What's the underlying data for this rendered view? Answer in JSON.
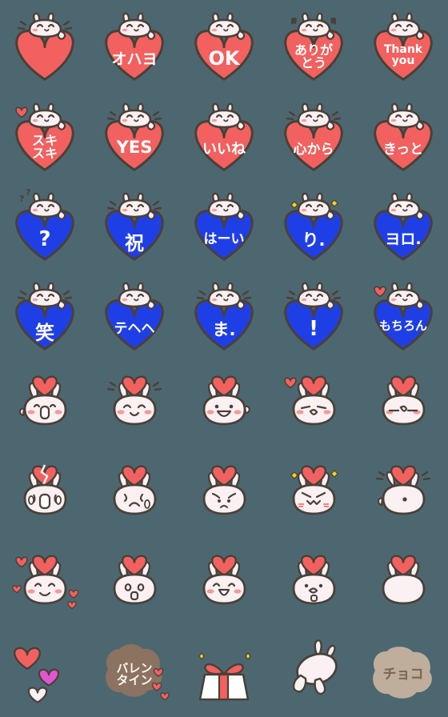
{
  "page": {
    "title": "Heart Rabbit Emoji Set",
    "background_color": "#4d6770",
    "columns": 5,
    "rows": 8,
    "total_items": 40
  },
  "palette": {
    "background": "#4d6770",
    "heart_red": "#f2615f",
    "heart_blue": "#1f3fe6",
    "body_white": "#fbf0f2",
    "outline": "#4a4038",
    "blush": "#f4837f",
    "chocolate_dark": "#8b7261",
    "chocolate_light": "#bfae9c",
    "caption_white": "#ffffff",
    "spark_yellow": "#f5d21c",
    "pink_heart": "#e255d0"
  },
  "items": [
    {
      "id": 1,
      "row": 1,
      "col": 1,
      "kind": "red-heart-rabbit",
      "caption": "",
      "caption_size": 0,
      "name": "emoji-heart-plain",
      "accents": "motion-lines"
    },
    {
      "id": 2,
      "row": 1,
      "col": 2,
      "kind": "red-heart-rabbit",
      "caption": "オハヨ",
      "caption_size": 19,
      "name": "emoji-ohayo",
      "accents": "none"
    },
    {
      "id": 3,
      "row": 1,
      "col": 3,
      "kind": "red-heart-rabbit",
      "caption": "OK",
      "caption_size": 24,
      "name": "emoji-ok",
      "accents": "none"
    },
    {
      "id": 4,
      "row": 1,
      "col": 4,
      "kind": "red-heart-rabbit",
      "caption": "ありが\nとう",
      "caption_size": 16,
      "name": "emoji-arigatou",
      "accents": "music-notes"
    },
    {
      "id": 5,
      "row": 1,
      "col": 5,
      "kind": "red-heart-rabbit",
      "caption": "Thank\nyou",
      "caption_size": 14,
      "name": "emoji-thank-you",
      "accents": "none"
    },
    {
      "id": 6,
      "row": 2,
      "col": 1,
      "kind": "red-heart-rabbit",
      "caption": "スキ\nスキ",
      "caption_size": 16,
      "name": "emoji-suki-suki",
      "accents": "small-heart"
    },
    {
      "id": 7,
      "row": 2,
      "col": 2,
      "kind": "red-heart-rabbit",
      "caption": "YES",
      "caption_size": 21,
      "name": "emoji-yes",
      "accents": "motion-lines"
    },
    {
      "id": 8,
      "row": 2,
      "col": 3,
      "kind": "red-heart-rabbit",
      "caption": "いいね",
      "caption_size": 18,
      "name": "emoji-iine",
      "accents": "none"
    },
    {
      "id": 9,
      "row": 2,
      "col": 4,
      "kind": "red-heart-rabbit",
      "caption": "心から",
      "caption_size": 17,
      "name": "emoji-kokoro-kara",
      "accents": "motion-lines"
    },
    {
      "id": 10,
      "row": 2,
      "col": 5,
      "kind": "red-heart-rabbit",
      "caption": "きっと",
      "caption_size": 17,
      "name": "emoji-kitto",
      "accents": "none"
    },
    {
      "id": 11,
      "row": 3,
      "col": 1,
      "kind": "blue-heart-rabbit",
      "caption": "?",
      "caption_size": 26,
      "name": "emoji-question",
      "accents": "question-marks"
    },
    {
      "id": 12,
      "row": 3,
      "col": 2,
      "kind": "blue-heart-rabbit",
      "caption": "祝",
      "caption_size": 24,
      "name": "emoji-iwai",
      "accents": "motion-lines"
    },
    {
      "id": 13,
      "row": 3,
      "col": 3,
      "kind": "blue-heart-rabbit",
      "caption": "はーい",
      "caption_size": 17,
      "name": "emoji-haai",
      "accents": "none"
    },
    {
      "id": 14,
      "row": 3,
      "col": 4,
      "kind": "blue-heart-rabbit",
      "caption": "り.",
      "caption_size": 21,
      "name": "emoji-ri",
      "accents": "spark"
    },
    {
      "id": 15,
      "row": 3,
      "col": 5,
      "kind": "blue-heart-rabbit",
      "caption": "ヨロ.",
      "caption_size": 19,
      "name": "emoji-yoro",
      "accents": "none"
    },
    {
      "id": 16,
      "row": 4,
      "col": 1,
      "kind": "blue-heart-rabbit",
      "caption": "笑",
      "caption_size": 24,
      "name": "emoji-warai",
      "accents": "motion-lines"
    },
    {
      "id": 17,
      "row": 4,
      "col": 2,
      "kind": "blue-heart-rabbit",
      "caption": "テヘヘ",
      "caption_size": 17,
      "name": "emoji-tehehe",
      "accents": "none"
    },
    {
      "id": 18,
      "row": 4,
      "col": 3,
      "kind": "blue-heart-rabbit",
      "caption": "ま.",
      "caption_size": 21,
      "name": "emoji-ma",
      "accents": "motion-lines"
    },
    {
      "id": 19,
      "row": 4,
      "col": 4,
      "kind": "blue-heart-rabbit",
      "caption": "!",
      "caption_size": 26,
      "name": "emoji-exclamation",
      "accents": "motion-lines"
    },
    {
      "id": 20,
      "row": 4,
      "col": 5,
      "kind": "blue-heart-rabbit",
      "caption": "もちろん",
      "caption_size": 15,
      "name": "emoji-mochiron",
      "accents": "small-heart"
    },
    {
      "id": 21,
      "row": 5,
      "col": 1,
      "kind": "face",
      "face": "open-smile",
      "heart": "red",
      "caption": "",
      "caption_size": 0,
      "name": "emoji-face-open-smile",
      "accents": "none"
    },
    {
      "id": 22,
      "row": 5,
      "col": 2,
      "kind": "face",
      "face": "happy-lines",
      "heart": "red",
      "caption": "",
      "caption_size": 0,
      "name": "emoji-face-happy",
      "accents": "motion-lines"
    },
    {
      "id": 23,
      "row": 5,
      "col": 3,
      "kind": "face",
      "face": "big-grin",
      "heart": "red",
      "caption": "",
      "caption_size": 0,
      "name": "emoji-face-big-grin",
      "accents": "none"
    },
    {
      "id": 24,
      "row": 5,
      "col": 4,
      "kind": "face",
      "face": "kiss",
      "heart": "red",
      "caption": "",
      "caption_size": 0,
      "name": "emoji-face-kiss",
      "accents": "small-heart"
    },
    {
      "id": 25,
      "row": 5,
      "col": 5,
      "kind": "face",
      "face": "flat-kiss",
      "heart": "red",
      "caption": "",
      "caption_size": 0,
      "name": "emoji-face-flat-kiss",
      "accents": "none"
    },
    {
      "id": 26,
      "row": 6,
      "col": 1,
      "kind": "face",
      "face": "crying",
      "heart": "broken",
      "caption": "",
      "caption_size": 0,
      "name": "emoji-face-crying",
      "accents": "none"
    },
    {
      "id": 27,
      "row": 6,
      "col": 2,
      "kind": "face",
      "face": "sad-tear",
      "heart": "red",
      "caption": "",
      "caption_size": 0,
      "name": "emoji-face-sad-tear",
      "accents": "none"
    },
    {
      "id": 28,
      "row": 6,
      "col": 3,
      "kind": "face",
      "face": "worried",
      "heart": "red",
      "caption": "",
      "caption_size": 0,
      "name": "emoji-face-worried",
      "accents": "none"
    },
    {
      "id": 29,
      "row": 6,
      "col": 4,
      "kind": "face",
      "face": "angry",
      "heart": "red",
      "caption": "",
      "caption_size": 0,
      "name": "emoji-face-angry",
      "accents": "spark"
    },
    {
      "id": 30,
      "row": 6,
      "col": 5,
      "kind": "face",
      "face": "turned",
      "heart": "red",
      "caption": "",
      "caption_size": 0,
      "name": "emoji-face-turned-away",
      "accents": "motion-lines"
    },
    {
      "id": 31,
      "row": 7,
      "col": 1,
      "kind": "face",
      "face": "blushing",
      "heart": "red",
      "caption": "",
      "caption_size": 0,
      "name": "emoji-face-blushing",
      "accents": "small-heart"
    },
    {
      "id": 32,
      "row": 7,
      "col": 2,
      "kind": "face",
      "face": "surprised",
      "heart": "red",
      "caption": "",
      "caption_size": 0,
      "name": "emoji-face-surprised",
      "accents": "none"
    },
    {
      "id": 33,
      "row": 7,
      "col": 3,
      "kind": "face",
      "face": "laughing",
      "heart": "red",
      "caption": "",
      "caption_size": 0,
      "name": "emoji-face-laughing",
      "accents": "none"
    },
    {
      "id": 34,
      "row": 7,
      "col": 4,
      "kind": "face",
      "face": "shocked",
      "heart": "red",
      "caption": "",
      "caption_size": 0,
      "name": "emoji-face-shocked",
      "accents": "none"
    },
    {
      "id": 35,
      "row": 7,
      "col": 5,
      "kind": "face",
      "face": "blank",
      "heart": "red",
      "caption": "",
      "caption_size": 0,
      "name": "emoji-face-blank",
      "accents": "none"
    },
    {
      "id": 36,
      "row": 8,
      "col": 1,
      "kind": "hearts-trio",
      "caption": "",
      "caption_size": 0,
      "name": "emoji-three-hearts",
      "accents": "none"
    },
    {
      "id": 37,
      "row": 8,
      "col": 2,
      "kind": "choco-dark",
      "caption": "バレン\nタイン",
      "caption_size": 15,
      "name": "emoji-valentine",
      "accents": "small-hearts"
    },
    {
      "id": 38,
      "row": 8,
      "col": 3,
      "kind": "gift",
      "caption": "",
      "caption_size": 0,
      "name": "emoji-gift-box",
      "accents": "spark"
    },
    {
      "id": 39,
      "row": 8,
      "col": 4,
      "kind": "rabbit-body",
      "caption": "",
      "caption_size": 0,
      "name": "emoji-rabbit-bowing",
      "accents": "none"
    },
    {
      "id": 40,
      "row": 8,
      "col": 5,
      "kind": "choco-light",
      "caption": "チョコ",
      "caption_size": 17,
      "name": "emoji-choco",
      "accents": "none"
    }
  ]
}
